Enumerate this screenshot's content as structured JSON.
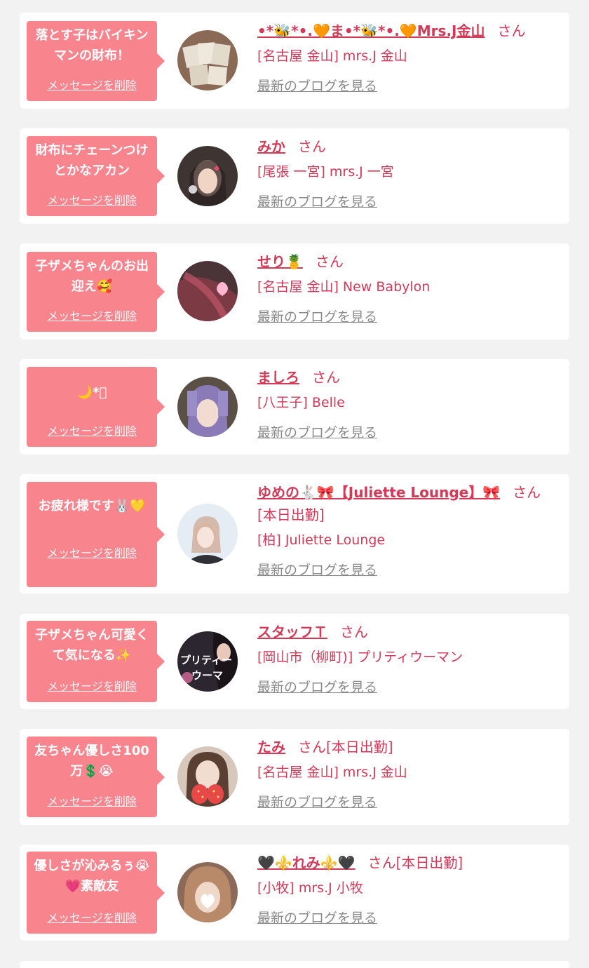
{
  "cards": [
    {
      "message": "落とす子はバイキンマンの財布！",
      "delete_label": "メッセージを削除",
      "name": "•*🐝*•.🧡ま•*🐝*•.🧡Mrs.J金山",
      "san": "さん",
      "status": "",
      "shop": "[名古屋 金山] mrs.J 金山",
      "blog_label": "最新のブログを見る",
      "avatar_color": "#c9b9a4"
    },
    {
      "message": "財布にチェーンつけとかなアカン",
      "delete_label": "メッセージを削除",
      "name": "みか",
      "san": "さん",
      "status": "",
      "shop": "[尾張 一宮] mrs.J 一宮",
      "blog_label": "最新のブログを見る",
      "avatar_color": "#5a4a46"
    },
    {
      "message": "子ザメちゃんのお出迎え🥰",
      "delete_label": "メッセージを削除",
      "name": "せり🍍",
      "san": "さん",
      "status": "",
      "shop": "[名古屋 金山] New Babylon",
      "blog_label": "最新のブログを見る",
      "avatar_color": "#7a4a4e"
    },
    {
      "message": "🌙*ﾟ",
      "delete_label": "メッセージを削除",
      "name": "ましろ",
      "san": "さん",
      "status": "",
      "shop": "[八王子] Belle",
      "blog_label": "最新のブログを見る",
      "avatar_color": "#8a7aa8"
    },
    {
      "message": "お疲れ様です🐰💛",
      "delete_label": "メッセージを削除",
      "name": "ゆめの🐇🎀【Juliette Lounge】🎀",
      "san": "さん",
      "status": "[本日出勤]",
      "shop": "[柏] Juliette Lounge",
      "blog_label": "最新のブログを見る",
      "avatar_color": "#dfe6f0"
    },
    {
      "message": "子ザメちゃん可愛くて気になる✨",
      "delete_label": "メッセージを削除",
      "name": "スタッフＴ",
      "san": "さん",
      "status": "",
      "shop": "[岡山市（柳町)] プリティウーマン",
      "blog_label": "最新のブログを見る",
      "avatar_color": "#2b2630",
      "avatar_text": "プリティーウーマ"
    },
    {
      "message": "友ちゃん優しさ100万💲😭",
      "delete_label": "メッセージを削除",
      "name": "たみ",
      "san": "さん",
      "status": "[本日出勤]",
      "shop": "[名古屋 金山] mrs.J 金山",
      "blog_label": "最新のブログを見る",
      "avatar_color": "#d9c2b4"
    },
    {
      "message": "優しさが沁みるぅ😭💗素敵友",
      "delete_label": "メッセージを削除",
      "name": "🖤⚜️れみ⚜️🖤",
      "san": "さん",
      "status": "[本日出勤]",
      "shop": "[小牧] mrs.J 小牧",
      "blog_label": "最新のブログを見る",
      "avatar_color": "#a08070"
    }
  ]
}
